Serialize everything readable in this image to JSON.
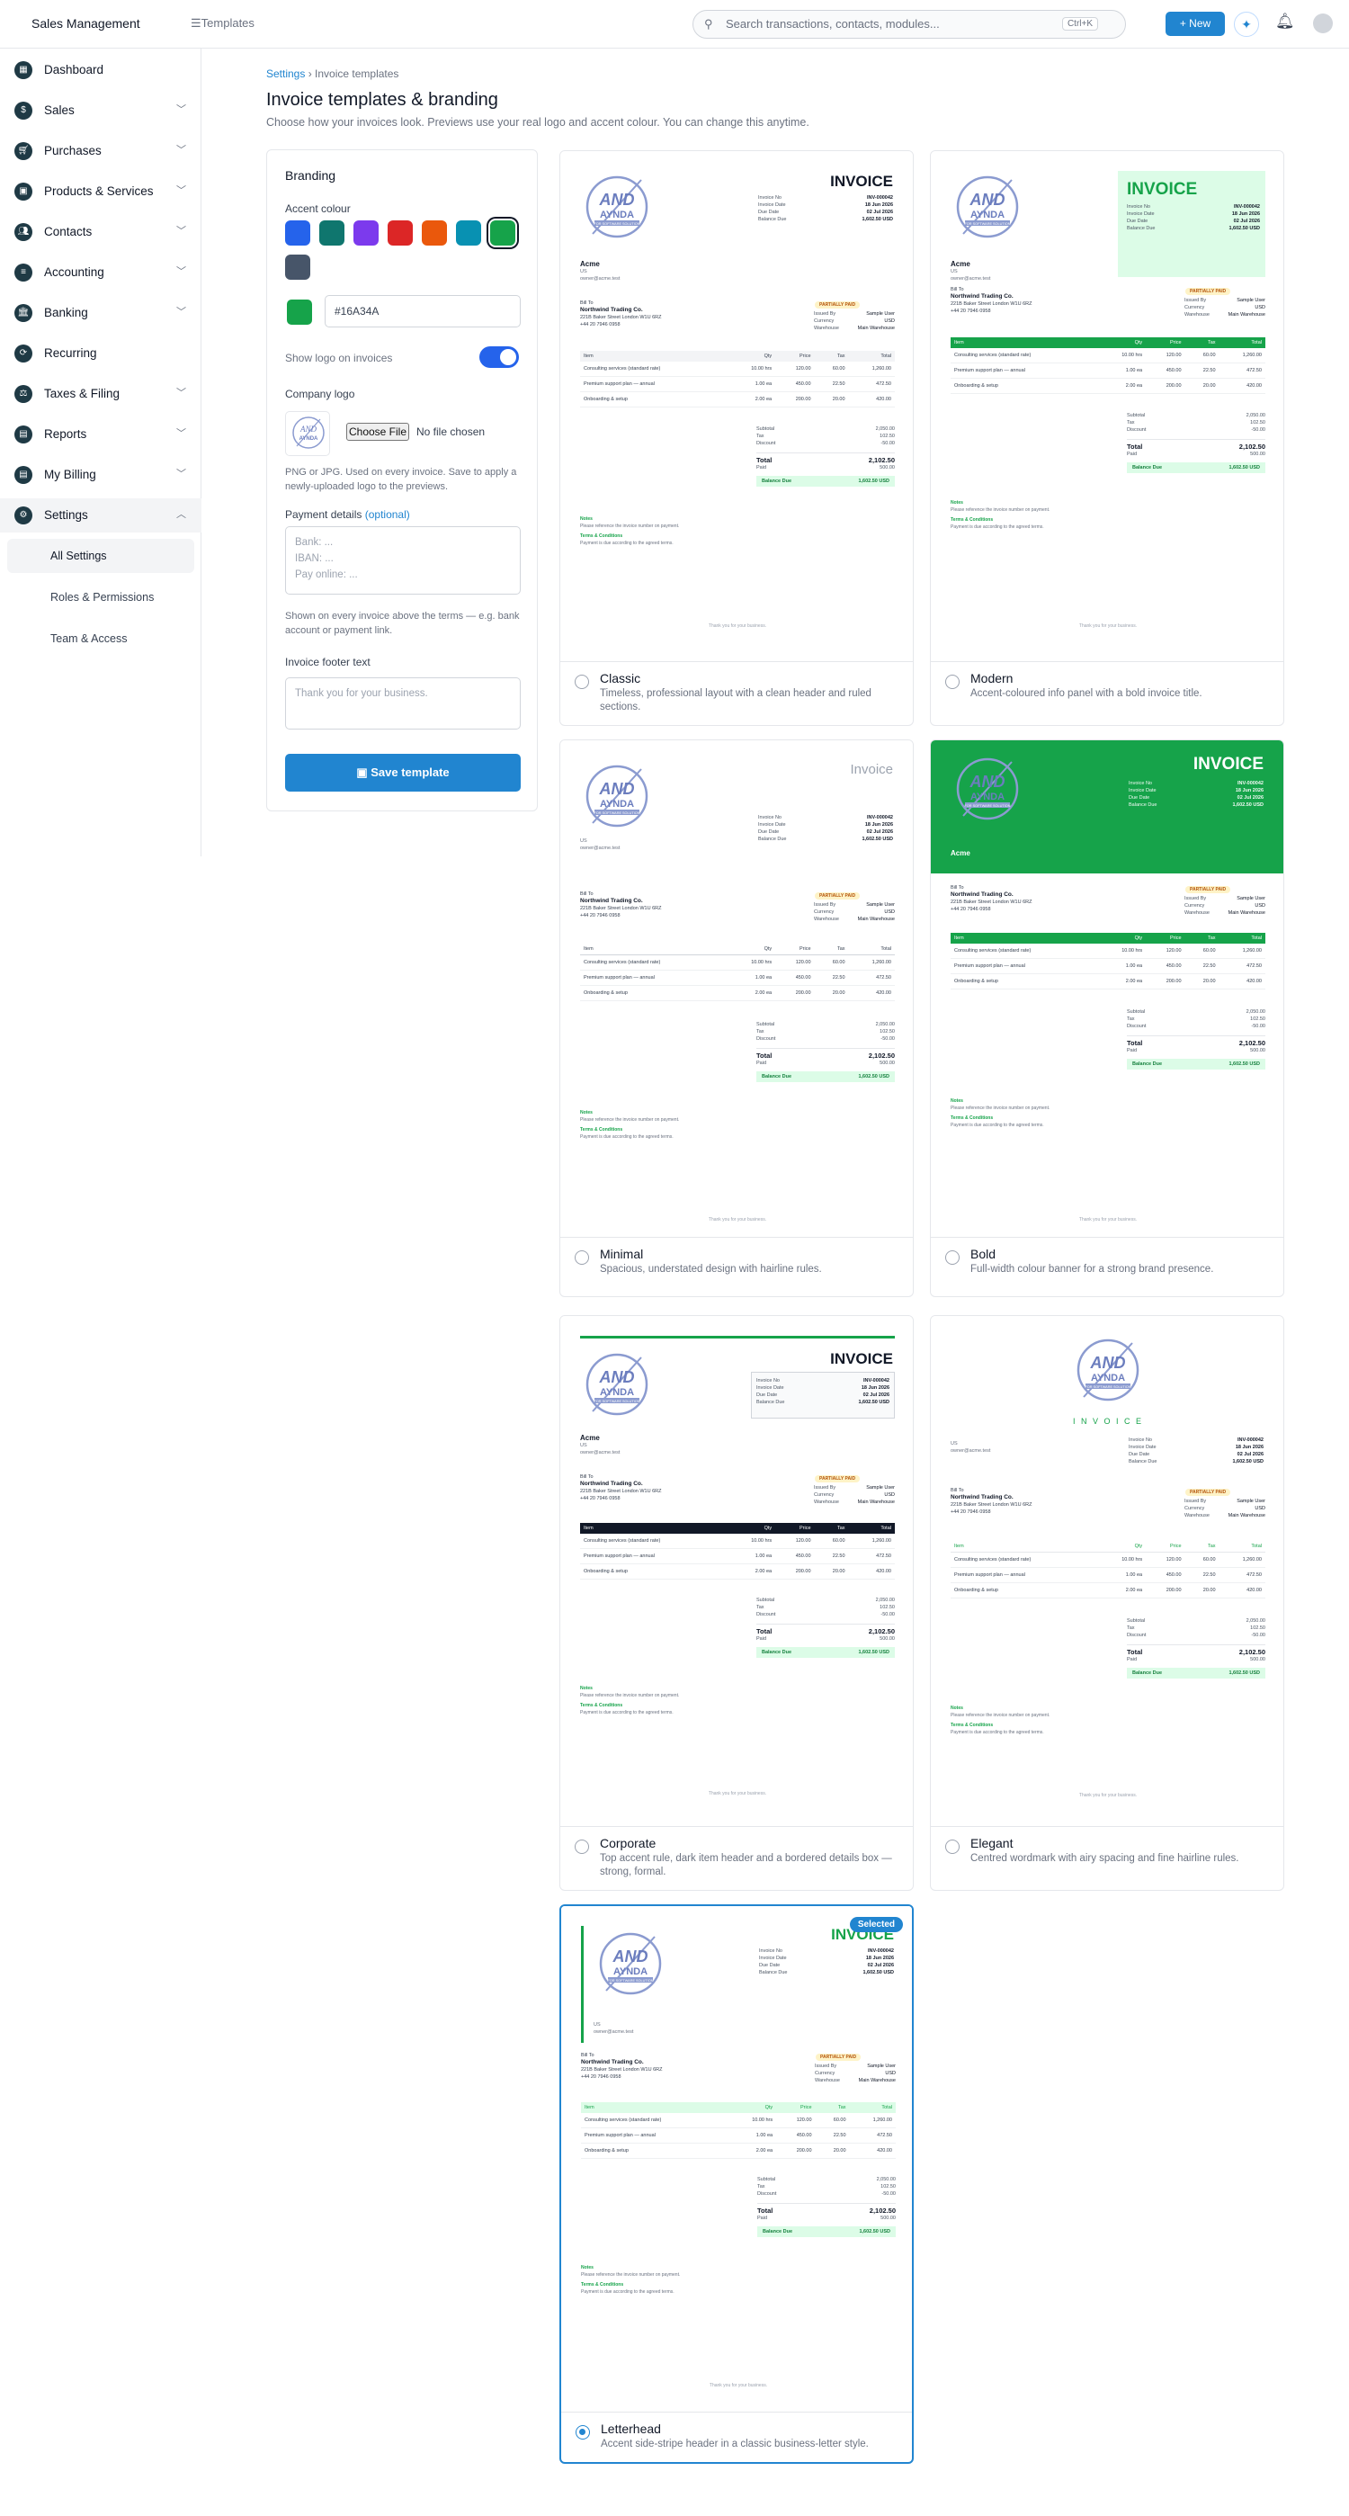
{
  "topbar": {
    "brand": "Sales Management",
    "section": "Templates",
    "search_placeholder": "Search transactions, contacts, modules...",
    "shortcut": "Ctrl+K",
    "new_label": "+ New"
  },
  "sidebar": {
    "items": [
      {
        "label": "Dashboard",
        "icon": "dashboard-icon",
        "chevron": false
      },
      {
        "label": "Sales",
        "icon": "sales-icon",
        "chevron": true
      },
      {
        "label": "Purchases",
        "icon": "cart-icon",
        "chevron": true
      },
      {
        "label": "Products & Services",
        "icon": "box-icon",
        "chevron": true
      },
      {
        "label": "Contacts",
        "icon": "contacts-icon",
        "chevron": true
      },
      {
        "label": "Accounting",
        "icon": "accounting-icon",
        "chevron": true
      },
      {
        "label": "Banking",
        "icon": "bank-icon",
        "chevron": true
      },
      {
        "label": "Recurring",
        "icon": "recurring-icon",
        "chevron": false
      },
      {
        "label": "Taxes & Filing",
        "icon": "tax-icon",
        "chevron": true
      },
      {
        "label": "Reports",
        "icon": "reports-icon",
        "chevron": true
      },
      {
        "label": "My Billing",
        "icon": "billing-icon",
        "chevron": true
      },
      {
        "label": "Settings",
        "icon": "gear-icon",
        "chevron": true
      }
    ],
    "settings_sub": [
      "All Settings",
      "Roles & Permissions",
      "Team & Access"
    ]
  },
  "page": {
    "breadcrumb_link": "Settings",
    "breadcrumb_sep": " › ",
    "breadcrumb_current": "Invoice templates",
    "title": "Invoice templates & branding",
    "subtitle": "Choose how your invoices look. Previews use your real logo and accent colour. You can change this anytime."
  },
  "branding": {
    "heading": "Branding",
    "accent_label": "Accent colour",
    "swatches": [
      "#2563eb",
      "#0f766e",
      "#7c3aed",
      "#dc2626",
      "#ea580c",
      "#0891b2",
      "#16a34a",
      "#475569"
    ],
    "selected_swatch": 6,
    "hex_value": "#16A34A",
    "accent": "#16A34A",
    "show_logo_label": "Show logo on invoices",
    "company_logo_label": "Company logo",
    "choose_file": "Choose File",
    "no_file": "No file chosen",
    "logo_hint": "PNG or JPG. Used on every invoice. Save to apply a newly-uploaded logo to the previews.",
    "payment_label": "Payment details",
    "payment_optional": "(optional)",
    "payment_placeholder_1": "Bank: ...",
    "payment_placeholder_2": "IBAN: ...",
    "payment_placeholder_3": "Pay online: ...",
    "payment_hint": "Shown on every invoice above the terms — e.g. bank account or payment link.",
    "footer_label": "Invoice footer text",
    "footer_placeholder": "Thank you for your business.",
    "save_label": "Save template"
  },
  "invoice": {
    "title": "INVOICE",
    "title_minimal": "Invoice",
    "title_elegant": "I N V O I C E",
    "logo_text_1": "AND",
    "logo_text_2": "AYNDA",
    "logo_text_3": "FOR SOFTWARE SOLUTION",
    "meta": [
      {
        "k": "Invoice No",
        "v": "INV-000042"
      },
      {
        "k": "Invoice Date",
        "v": "18 Jun 2026"
      },
      {
        "k": "Due Date",
        "v": "02 Jul 2026"
      },
      {
        "k": "Balance Due",
        "v": "1,602.50 USD"
      }
    ],
    "seller_name": "Acme",
    "seller_lines": [
      "US",
      "owner@acme.test"
    ],
    "bill_to": "Bill To",
    "client": "Northwind Trading Co.",
    "client_lines": [
      "221B Baker Street London W1U 6RZ",
      "+44 20 7946 0958"
    ],
    "status": "PARTIALLY PAID",
    "right_meta": [
      {
        "k": "Issued By",
        "v": "Sample User"
      },
      {
        "k": "Currency",
        "v": "USD"
      },
      {
        "k": "Warehouse",
        "v": "Main Warehouse"
      }
    ],
    "columns": [
      "Item",
      "Qty",
      "Price",
      "Tax",
      "Total"
    ],
    "rows": [
      [
        "Consulting services (standard rate)",
        "10.00 hrs",
        "120.00",
        "60.00",
        "1,260.00"
      ],
      [
        "Premium support plan — annual",
        "1.00 ea",
        "450.00",
        "22.50",
        "472.50"
      ],
      [
        "Onboarding & setup",
        "2.00 ea",
        "200.00",
        "20.00",
        "420.00"
      ]
    ],
    "totals": [
      {
        "k": "Subtotal",
        "v": "2,050.00"
      },
      {
        "k": "Tax",
        "v": "102.50"
      },
      {
        "k": "Discount",
        "v": "-50.00"
      }
    ],
    "total_label": "Total",
    "total_value": "2,102.50",
    "paid_label": "Paid",
    "paid_value": "500.00",
    "balance_label": "Balance Due",
    "balance_value": "1,602.50 USD",
    "notes_label": "Notes",
    "notes_text": "Please reference the invoice number on payment.",
    "terms_label": "Terms & Conditions",
    "terms_text": "Payment is due according to the agreed terms.",
    "fine_print": "Thank you for your business."
  },
  "templates": [
    {
      "id": "classic",
      "name": "Classic",
      "desc": "Timeless, professional layout with a clean header and ruled sections.",
      "selected": false
    },
    {
      "id": "modern",
      "name": "Modern",
      "desc": "Accent-coloured info panel with a bold invoice title.",
      "selected": false
    },
    {
      "id": "minimal",
      "name": "Minimal",
      "desc": "Spacious, understated design with hairline rules.",
      "selected": false
    },
    {
      "id": "bold",
      "name": "Bold",
      "desc": "Full-width colour banner for a strong brand presence.",
      "selected": false
    },
    {
      "id": "corporate",
      "name": "Corporate",
      "desc": "Top accent rule, dark item header and a bordered details box — strong, formal.",
      "selected": false
    },
    {
      "id": "elegant",
      "name": "Elegant",
      "desc": "Centred wordmark with airy spacing and fine hairline rules.",
      "selected": false
    },
    {
      "id": "letterhead",
      "name": "Letterhead",
      "desc": "Accent side-stripe header in a classic business-letter style.",
      "selected": true
    }
  ],
  "selected_badge": "Selected"
}
